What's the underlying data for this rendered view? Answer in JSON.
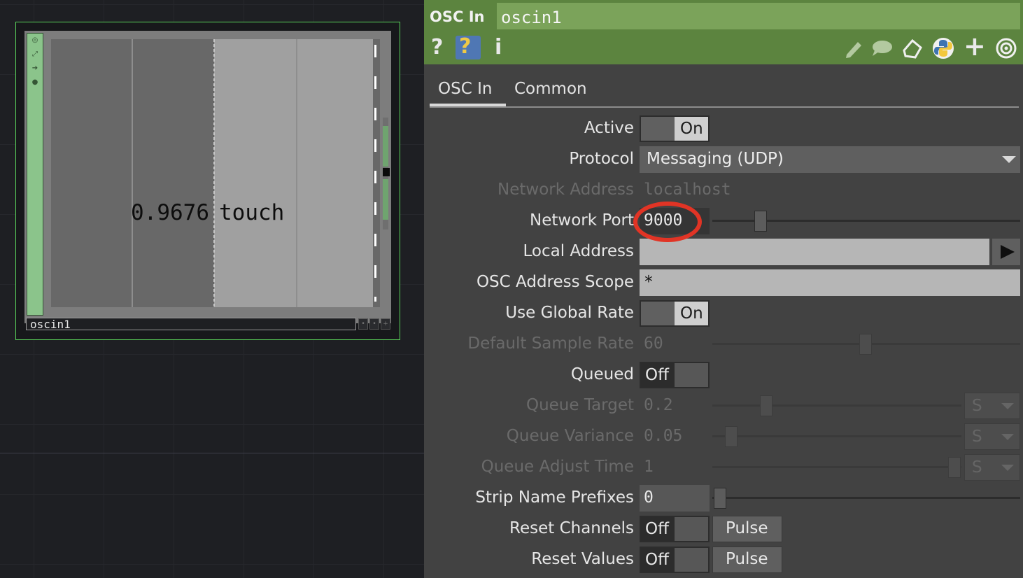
{
  "network": {
    "node": {
      "name": "oscin1",
      "channel_value": "0.9676",
      "channel_name": "touch",
      "strip_icons": [
        "viewer-toggle-icon",
        "bypass-icon",
        "output-icon",
        "lock-icon"
      ]
    }
  },
  "panel": {
    "op_type": "OSC In",
    "op_name": "oscin1",
    "header_icons": [
      "help-icon",
      "python-help-icon",
      "info-icon",
      "edit-icon",
      "comment-icon",
      "clone-icon",
      "python-icon",
      "add-icon",
      "target-icon"
    ],
    "help_label": "?",
    "info_label": "i",
    "add_label": "+",
    "tabs": [
      {
        "label": "OSC In",
        "active": true
      },
      {
        "label": "Common",
        "active": false
      }
    ],
    "params": {
      "active": {
        "label": "Active",
        "value": "On"
      },
      "protocol": {
        "label": "Protocol",
        "value": "Messaging (UDP)"
      },
      "network_address": {
        "label": "Network Address",
        "value": "localhost"
      },
      "network_port": {
        "label": "Network Port",
        "value": "9000"
      },
      "local_address": {
        "label": "Local Address",
        "value": ""
      },
      "osc_address_scope": {
        "label": "OSC Address Scope",
        "value": "*"
      },
      "use_global_rate": {
        "label": "Use Global Rate",
        "value": "On"
      },
      "default_sample_rate": {
        "label": "Default Sample Rate",
        "value": "60"
      },
      "queued": {
        "label": "Queued",
        "value": "Off"
      },
      "queue_target": {
        "label": "Queue Target",
        "value": "0.2",
        "unit": "S"
      },
      "queue_variance": {
        "label": "Queue Variance",
        "value": "0.05",
        "unit": "S"
      },
      "queue_adjust_time": {
        "label": "Queue Adjust Time",
        "value": "1",
        "unit": "S"
      },
      "strip_name_prefixes": {
        "label": "Strip Name Prefixes",
        "value": "0"
      },
      "reset_channels": {
        "label": "Reset Channels",
        "value": "Off",
        "pulse": "Pulse"
      },
      "reset_values": {
        "label": "Reset Values",
        "value": "Off",
        "pulse": "Pulse"
      }
    },
    "highlight_color": "#e13425",
    "header_color": "#5c843f"
  }
}
